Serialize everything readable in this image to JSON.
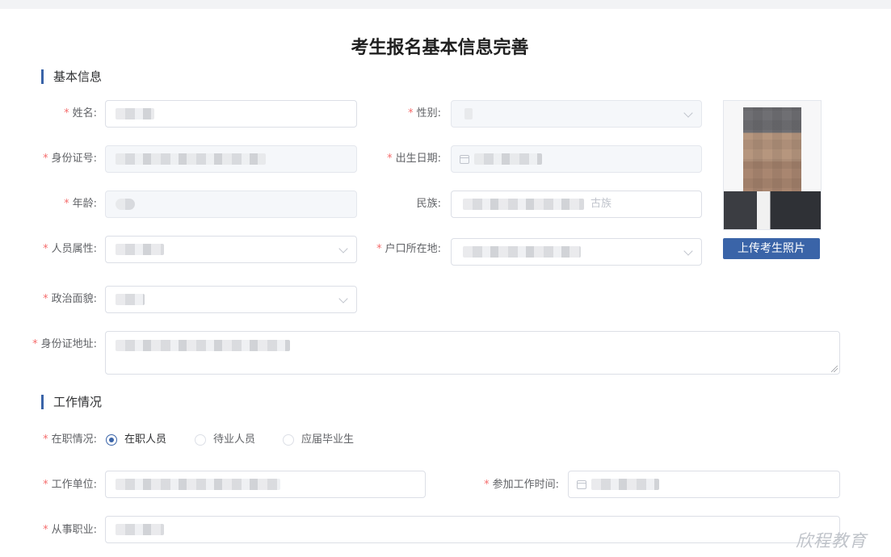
{
  "page_title": "考生报名基本信息完善",
  "sections": {
    "basic": "基本信息",
    "work": "工作情况"
  },
  "required_mark": "*",
  "fields": {
    "name": {
      "label": "姓名:"
    },
    "gender": {
      "label": "性别:"
    },
    "id_number": {
      "label": "身份证号:"
    },
    "birth_date": {
      "label": "出生日期:"
    },
    "age": {
      "label": "年龄:"
    },
    "ethnicity": {
      "label": "民族:",
      "visible_value_tail": "古族"
    },
    "person_type": {
      "label": "人员属性:"
    },
    "household": {
      "label": "户口所在地:"
    },
    "political": {
      "label": "政治面貌:"
    },
    "id_address": {
      "label": "身份证地址:"
    },
    "employment_status": {
      "label": "在职情况:",
      "options": [
        "在职人员",
        "待业人员",
        "应届毕业生"
      ],
      "selected": "在职人员"
    },
    "employer": {
      "label": "工作单位:"
    },
    "work_start": {
      "label": "参加工作时间:"
    },
    "occupation": {
      "label": "从事职业:"
    }
  },
  "photo": {
    "upload_label": "上传考生照片"
  },
  "watermark": "欣程教育",
  "colors": {
    "accent": "#3a64a8",
    "required": "#f56c6c",
    "border": "#dcdfe6",
    "disabled_bg": "#f5f7fa"
  }
}
